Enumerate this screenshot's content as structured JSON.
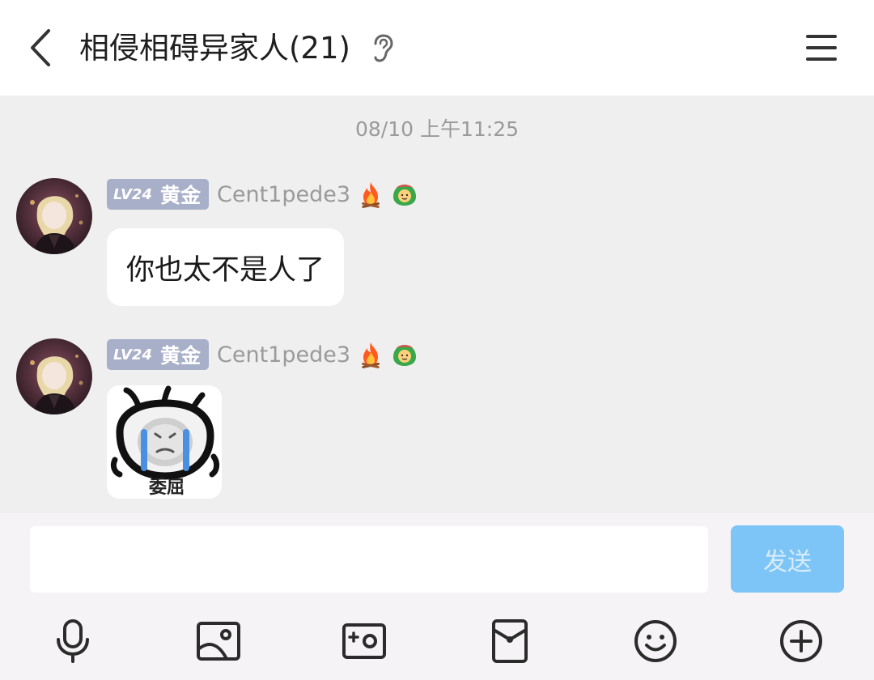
{
  "header": {
    "title": "相侵相碍异家人(21)",
    "back_icon": "chevron-left-icon",
    "ear_icon": "ear-icon",
    "menu_icon": "hamburger-menu-icon"
  },
  "chat": {
    "timestamp": "08/10 上午11:25",
    "messages": [
      {
        "level": "LV24",
        "rank": "黄金",
        "username": "Cent1pede3",
        "text": "你也太不是人了"
      },
      {
        "level": "LV24",
        "rank": "黄金",
        "username": "Cent1pede3",
        "sticker_caption": "委屈"
      }
    ]
  },
  "composer": {
    "input_value": "",
    "send_label": "发送"
  },
  "toolbar": {
    "icons": [
      "microphone-icon",
      "image-icon",
      "camera-icon",
      "red-packet-icon",
      "emoji-icon",
      "plus-icon"
    ]
  },
  "colors": {
    "chat_background": "#efefef",
    "badge": "#a8afc8",
    "send_button": "#7dc5f7",
    "composer_background": "#f6f3f6"
  }
}
